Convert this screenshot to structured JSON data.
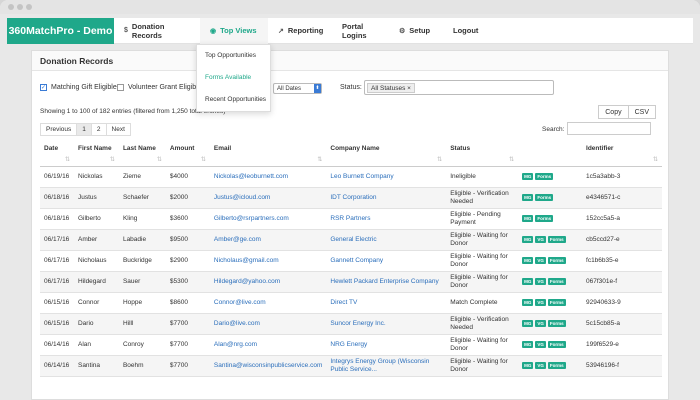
{
  "nav": {
    "brand": "360MatchPro - Demo",
    "items": [
      {
        "icon": "$",
        "label": "Donation Records"
      },
      {
        "icon": "◉",
        "label": "Top Views"
      },
      {
        "icon": "📈",
        "label": "Reporting"
      },
      {
        "icon": "",
        "label": "Portal Logins"
      },
      {
        "icon": "⚙",
        "label": "Setup"
      },
      {
        "icon": "",
        "label": "Logout"
      }
    ]
  },
  "dropdown": [
    "Top Opportunities",
    "Forms Available",
    "Recent Opportunities"
  ],
  "panel": {
    "title": "Donation Records",
    "matching_label": "Matching Gift Eligible",
    "volunteer_label": "Volunteer Grant Eligible",
    "date_value": "All Dates",
    "status_label": "Status:",
    "status_tag": "All Statuses",
    "showing": "Showing 1 to 100 of 182 entries (filtered from 1,250 total entries)",
    "copy": "Copy",
    "csv": "CSV",
    "prev": "Previous",
    "page1": "1",
    "page2": "2",
    "next": "Next",
    "search_label": "Search:"
  },
  "table": {
    "headers": [
      "Date",
      "First Name",
      "Last Name",
      "Amount",
      "Email",
      "Company Name",
      "Status",
      "",
      "Identifier"
    ],
    "rows": [
      {
        "date": "06/19/16",
        "first": "Nickolas",
        "last": "Zieme",
        "amount": "$4000",
        "email": "Nickolas@leoburnett.com",
        "company": "Leo Burnett Company",
        "status": "Ineligible",
        "badges": [
          "MG",
          "Forms"
        ],
        "id": "1c5a3abb-3"
      },
      {
        "date": "06/18/16",
        "first": "Justus",
        "last": "Schaefer",
        "amount": "$2000",
        "email": "Justus@icloud.com",
        "company": "IDT Corporation",
        "status": "Eligible - Verification Needed",
        "badges": [
          "MG",
          "Forms"
        ],
        "id": "e4346571-c"
      },
      {
        "date": "06/18/16",
        "first": "Gilberto",
        "last": "Kling",
        "amount": "$3600",
        "email": "Gilberto@rsrpartners.com",
        "company": "RSR Partners",
        "status": "Eligible - Pending Payment",
        "badges": [
          "MG",
          "Forms"
        ],
        "id": "152cc5a5-a"
      },
      {
        "date": "06/17/16",
        "first": "Amber",
        "last": "Labadie",
        "amount": "$9500",
        "email": "Amber@ge.com",
        "company": "General Electric",
        "status": "Eligible - Waiting for Donor",
        "badges": [
          "MG",
          "VG",
          "Forms"
        ],
        "id": "cb5ccd27-e"
      },
      {
        "date": "06/17/16",
        "first": "Nicholaus",
        "last": "Buckridge",
        "amount": "$2900",
        "email": "Nicholaus@gmail.com",
        "company": "Gannett Company",
        "status": "Eligible - Waiting for Donor",
        "badges": [
          "MG",
          "VG",
          "Forms"
        ],
        "id": "fc1b6b35-e"
      },
      {
        "date": "06/17/16",
        "first": "Hildegard",
        "last": "Sauer",
        "amount": "$5300",
        "email": "Hildegard@yahoo.com",
        "company": "Hewlett Packard Enterprise Company",
        "status": "Eligible - Waiting for Donor",
        "badges": [
          "MG",
          "VG",
          "Forms"
        ],
        "id": "067f301e-f"
      },
      {
        "date": "06/15/16",
        "first": "Connor",
        "last": "Hoppe",
        "amount": "$8600",
        "email": "Connor@live.com",
        "company": "Direct TV",
        "status": "Match Complete",
        "badges": [
          "MG",
          "VG",
          "Forms"
        ],
        "id": "92940633-9"
      },
      {
        "date": "06/15/16",
        "first": "Dario",
        "last": "Hilll",
        "amount": "$7700",
        "email": "Dario@live.com",
        "company": "Suncor Energy Inc.",
        "status": "Eligible - Verification Needed",
        "badges": [
          "MG",
          "VG",
          "Forms"
        ],
        "id": "5c15cb85-a"
      },
      {
        "date": "06/14/16",
        "first": "Alan",
        "last": "Conroy",
        "amount": "$7700",
        "email": "Alan@nrg.com",
        "company": "NRG Energy",
        "status": "Eligible - Waiting for Donor",
        "badges": [
          "MG",
          "VG",
          "Forms"
        ],
        "id": "199f6529-e"
      },
      {
        "date": "06/14/16",
        "first": "Santina",
        "last": "Boehm",
        "amount": "$7700",
        "email": "Santina@wisconsinpublicservice.com",
        "company": "Integrys Energy Group (Wisconsin Public Service...",
        "status": "Eligible - Waiting for Donor",
        "badges": [
          "MG",
          "VG",
          "Forms"
        ],
        "id": "53946196-f"
      }
    ]
  }
}
